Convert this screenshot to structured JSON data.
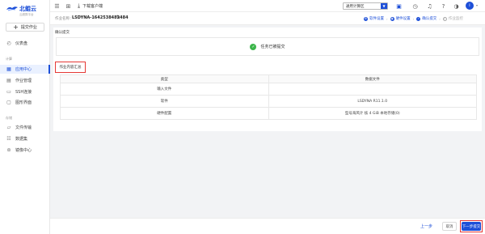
{
  "brand": {
    "name": "北鲲云",
    "subtitle": "云超算平台"
  },
  "sidebar": {
    "submit_label": "提交作业",
    "items": [
      {
        "label": "仪表盘",
        "icon": "dashboard-icon"
      },
      {
        "label": "应用中心",
        "icon": "app-center-icon",
        "active": true
      },
      {
        "label": "作业管理",
        "icon": "job-list-icon"
      },
      {
        "label": "SSH连接",
        "icon": "ssh-icon"
      },
      {
        "label": "图形界面",
        "icon": "monitor-icon"
      },
      {
        "label": "文件传输",
        "icon": "folder-icon"
      },
      {
        "label": "数据集",
        "icon": "database-icon"
      },
      {
        "label": "镜像中心",
        "icon": "image-center-icon"
      }
    ],
    "section_compute": "计算",
    "section_storage": "存储"
  },
  "topbar": {
    "download_label": "下载客户端",
    "region_value": "通用计算区",
    "avatar_letter": "i"
  },
  "subheader": {
    "job_label": "作业名称：",
    "job_name": "LSDYNA-1642538482484",
    "steps": [
      {
        "label": "软件设置",
        "state": "done"
      },
      {
        "label": "硬件设置",
        "state": "done"
      },
      {
        "label": "确认提交",
        "state": "active"
      },
      {
        "label": "作业监控",
        "state": "disabled"
      }
    ]
  },
  "panel": {
    "title": "确认提交",
    "success_message": "任务已被提交",
    "summary_label": "作业内容汇总",
    "table": {
      "headers": [
        "类型",
        "数据文件"
      ],
      "rows": [
        [
          "输入文件",
          ""
        ],
        [
          "软件",
          "LSDYNA R11.1.0"
        ],
        [
          "硬件配置",
          "型号海风计 核 4 GiB 本地存储(0)"
        ]
      ]
    }
  },
  "footer": {
    "prev_label": "上一步",
    "cancel_label": "取消",
    "submit_label": "下一步提交"
  },
  "colors": {
    "accent": "#1d4fd8",
    "highlight": "#e53935",
    "success": "#3bb54a"
  }
}
